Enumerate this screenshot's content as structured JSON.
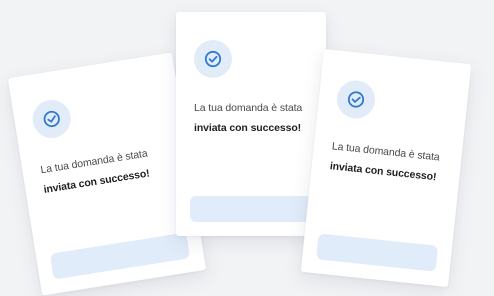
{
  "cards": [
    {
      "icon": "check-circle-icon",
      "message_prefix": "La tua domanda è stata",
      "message_bold": "inviata con successo!"
    },
    {
      "icon": "check-circle-icon",
      "message_prefix": "La tua domanda è stata",
      "message_bold": "inviata con successo!"
    },
    {
      "icon": "check-circle-icon",
      "message_prefix": "La tua domanda è stata",
      "message_bold": "inviata con successo!"
    }
  ],
  "colors": {
    "background": "#f2f3f5",
    "card": "#ffffff",
    "accent": "#2f79d4",
    "icon_bg": "#e2ecf9",
    "button_bg": "#e1ecfa"
  }
}
